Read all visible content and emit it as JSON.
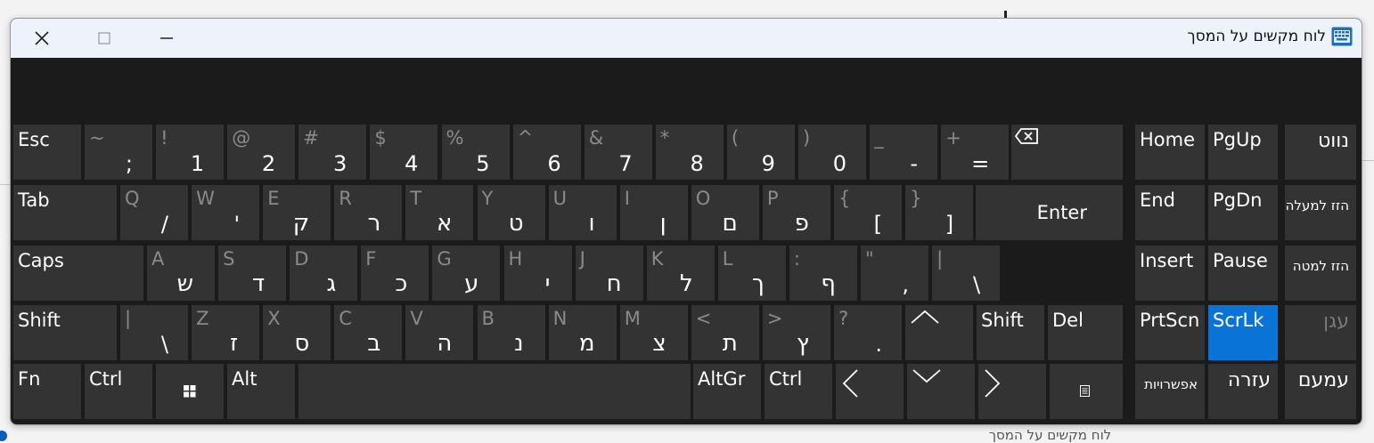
{
  "window": {
    "title": "לוח מקשים על המסך",
    "background_caption": "לוח מקשים על המסך"
  },
  "keyboard": {
    "esc": "Esc",
    "backspace_icon": "backspace-icon",
    "row1": [
      {
        "shift": "~",
        "main": ";"
      },
      {
        "shift": "!",
        "main": "1"
      },
      {
        "shift": "@",
        "main": "2"
      },
      {
        "shift": "#",
        "main": "3"
      },
      {
        "shift": "$",
        "main": "4"
      },
      {
        "shift": "%",
        "main": "5"
      },
      {
        "shift": "^",
        "main": "6"
      },
      {
        "shift": "&",
        "main": "7"
      },
      {
        "shift": "*",
        "main": "8"
      },
      {
        "shift": "(",
        "main": "9"
      },
      {
        "shift": ")",
        "main": "0"
      },
      {
        "shift": "_",
        "main": "-"
      },
      {
        "shift": "+",
        "main": "="
      }
    ],
    "tab": "Tab",
    "row2": [
      {
        "shift": "Q",
        "main": "/"
      },
      {
        "shift": "W",
        "main": "'"
      },
      {
        "shift": "E",
        "main": "ק"
      },
      {
        "shift": "R",
        "main": "ר"
      },
      {
        "shift": "T",
        "main": "א"
      },
      {
        "shift": "Y",
        "main": "ט"
      },
      {
        "shift": "U",
        "main": "ו"
      },
      {
        "shift": "I",
        "main": "ן"
      },
      {
        "shift": "O",
        "main": "ם"
      },
      {
        "shift": "P",
        "main": "פ"
      },
      {
        "shift": "{",
        "main": "["
      },
      {
        "shift": "}",
        "main": "]"
      }
    ],
    "enter": "Enter",
    "caps": "Caps",
    "row3": [
      {
        "shift": "A",
        "main": "ש"
      },
      {
        "shift": "S",
        "main": "ד"
      },
      {
        "shift": "D",
        "main": "ג"
      },
      {
        "shift": "F",
        "main": "כ"
      },
      {
        "shift": "G",
        "main": "ע"
      },
      {
        "shift": "H",
        "main": "י"
      },
      {
        "shift": "J",
        "main": "ח"
      },
      {
        "shift": "K",
        "main": "ל"
      },
      {
        "shift": "L",
        "main": "ך"
      },
      {
        "shift": ":",
        "main": "ף"
      },
      {
        "shift": "\"",
        "main": ","
      },
      {
        "shift": "|",
        "main": "\\"
      }
    ],
    "shift": "Shift",
    "row4": [
      {
        "shift": "|",
        "main": "\\"
      },
      {
        "shift": "Z",
        "main": "ז"
      },
      {
        "shift": "X",
        "main": "ס"
      },
      {
        "shift": "C",
        "main": "ב"
      },
      {
        "shift": "V",
        "main": "ה"
      },
      {
        "shift": "B",
        "main": "נ"
      },
      {
        "shift": "N",
        "main": "מ"
      },
      {
        "shift": "M",
        "main": "צ"
      },
      {
        "shift": "<",
        "main": "ת"
      },
      {
        "shift": ">",
        "main": "ץ"
      },
      {
        "shift": "?",
        "main": "."
      }
    ],
    "right_shift": "Shift",
    "del": "Del",
    "fn": "Fn",
    "ctrl": "Ctrl",
    "alt": "Alt",
    "altgr": "AltGr",
    "right_ctrl": "Ctrl"
  },
  "nav": {
    "home": "Home",
    "pgup": "PgUp",
    "nav_key": "נווט",
    "end": "End",
    "pgdn": "PgDn",
    "move_up": "הזז למעלה",
    "insert": "Insert",
    "pause": "Pause",
    "move_down": "הזז למטה",
    "prtscn": "PrtScn",
    "scrlk": "ScrLk",
    "dock": "עגן",
    "options": "אפשרויות",
    "help": "עזרה",
    "fade": "עמעם"
  },
  "colors": {
    "key": "#333333",
    "active": "#0a74d6",
    "board": "#1b1b1b"
  }
}
